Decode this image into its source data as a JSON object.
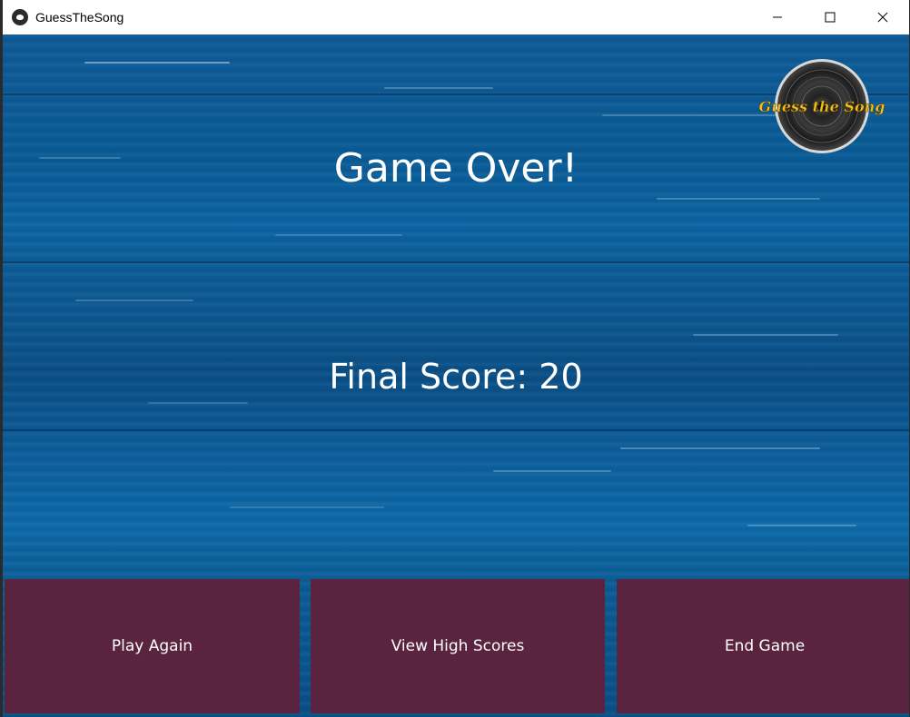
{
  "window": {
    "title": "GuessTheSong"
  },
  "logo": {
    "text": "Guess the Song"
  },
  "screen": {
    "title": "Game Over!",
    "final_score": "Final Score: 20"
  },
  "buttons": {
    "play_again": "Play Again",
    "view_high_scores": "View High Scores",
    "end_game": "End Game"
  },
  "colors": {
    "button_bg": "#5a2440",
    "background_blue": "#0d5a96",
    "logo_text": "#f2c21c"
  },
  "icons": {
    "app": "bird-icon",
    "minimize": "minimize-icon",
    "maximize": "maximize-icon",
    "close": "close-icon",
    "logo": "vinyl-record-icon"
  }
}
